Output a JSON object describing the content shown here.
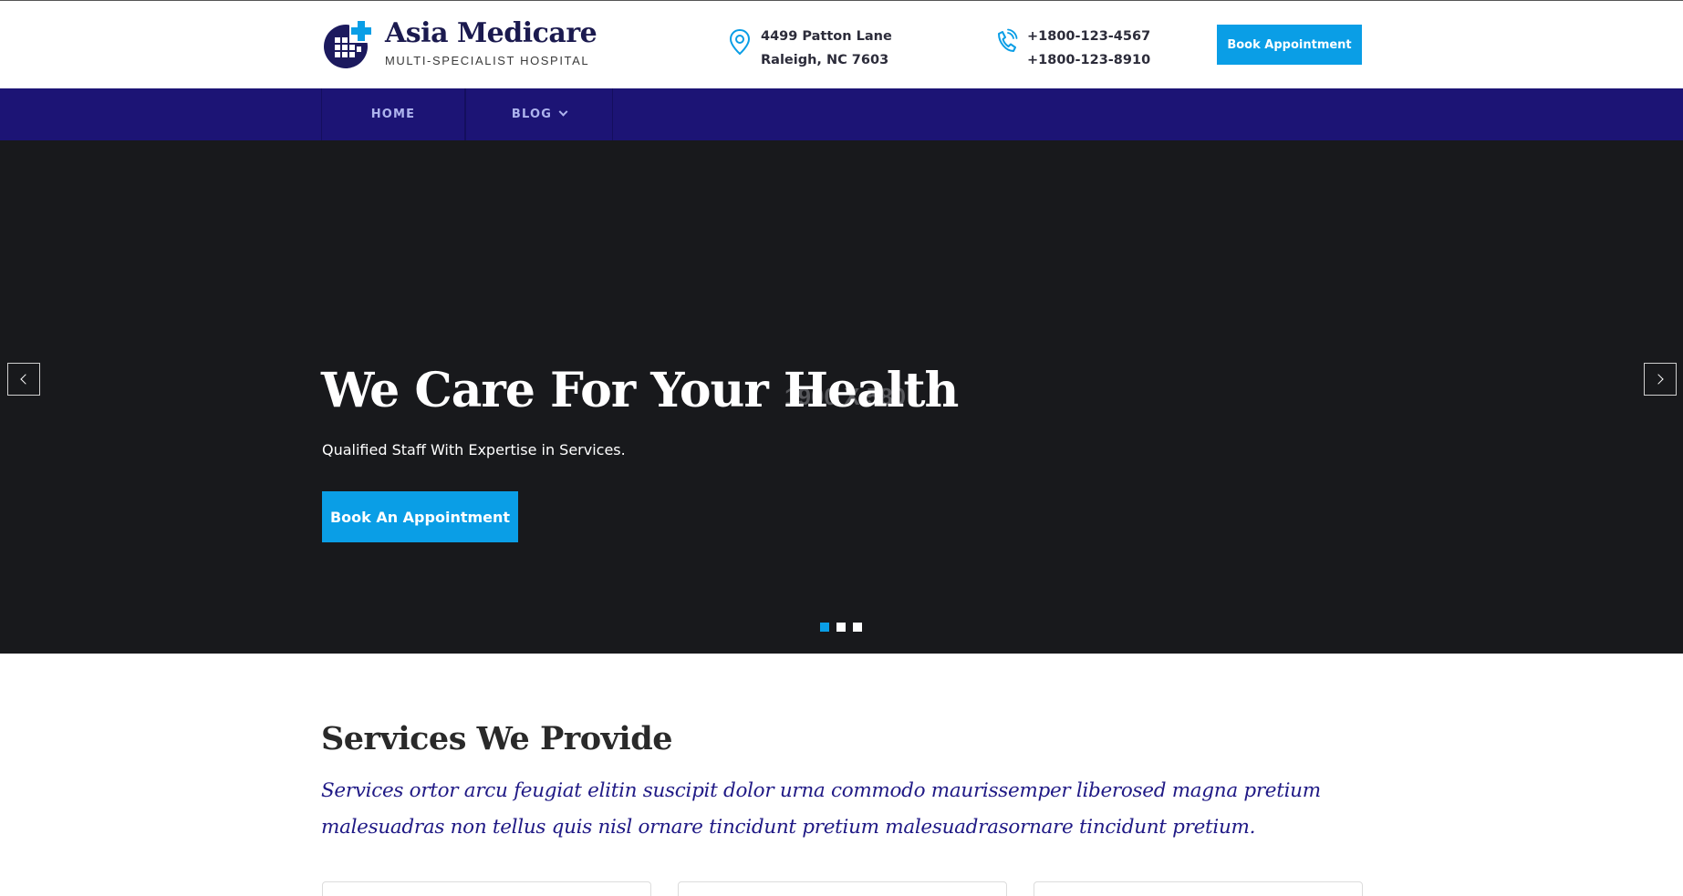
{
  "header": {
    "brand_name": "Asia Medicare",
    "brand_tagline": "MULTI-SPECIALIST HOSPITAL",
    "address_line1": "4499 Patton Lane",
    "address_line2": "Raleigh, NC 7603",
    "phone_line1": "+1800-123-4567",
    "phone_line2": "+1800-123-8910",
    "book_label": "Book Appointment"
  },
  "nav": {
    "items": [
      {
        "label": "HOME"
      },
      {
        "label": "BLOG"
      }
    ]
  },
  "hero": {
    "placeholder": "1900 X 580",
    "title": "We Care For Your Health",
    "subtitle": "Qualified Staff With Expertise in Services.",
    "cta_label": "Book An Appointment",
    "slide_count": 3,
    "active_slide": 1
  },
  "services": {
    "title": "Services We Provide",
    "description": "Services ortor arcu feugiat elitin suscipit dolor urna commodo maurissemper liberosed magna pretium malesuadras non tellus quis nisl ornare tincidunt pretium malesuadrasornare tincidunt pretium."
  },
  "icons": {
    "logo": "hospital-cross-globe-icon",
    "address": "map-pin-icon",
    "phone": "phone-icon",
    "dropdown": "chevron-down-icon",
    "prev": "chevron-left-icon",
    "next": "chevron-right-icon"
  },
  "colors": {
    "brand_navy": "#1c1475",
    "accent_blue": "#0a9ee6",
    "hero_bg": "#18191c"
  }
}
